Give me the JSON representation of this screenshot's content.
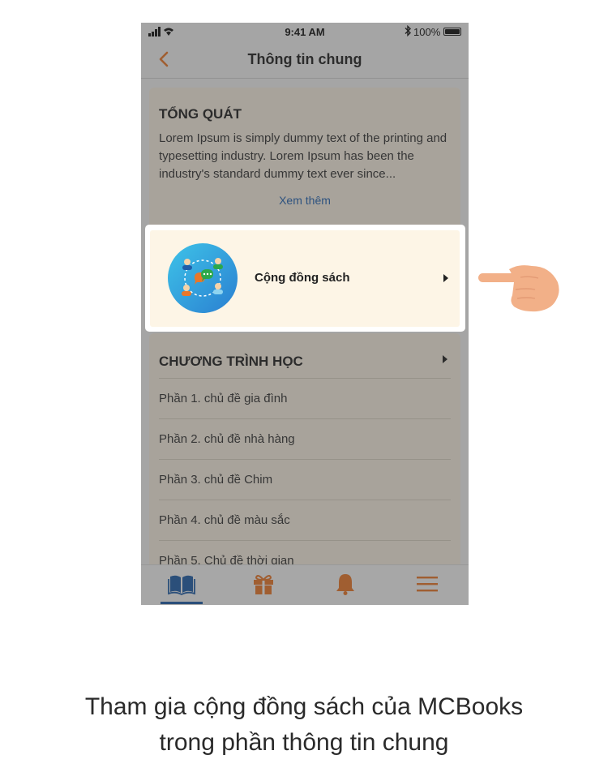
{
  "status_bar": {
    "time": "9:41 AM",
    "battery": "100%"
  },
  "nav": {
    "title": "Thông tin chung",
    "back_icon": "chevron-left-icon"
  },
  "overview": {
    "heading": "TỔNG QUÁT",
    "body": "Lorem Ipsum is simply dummy text of the printing and typesetting industry. Lorem Ipsum has been the industry's standard dummy text ever since...",
    "more_link": "Xem thêm"
  },
  "community": {
    "label": "Cộng đồng sách",
    "icon": "community-chat-icon"
  },
  "curriculum": {
    "heading": "CHƯƠNG TRÌNH HỌC",
    "lessons": [
      "Phần 1. chủ đề  gia đình",
      "Phần 2. chủ đề nhà hàng",
      "Phần 3. chủ đề Chim",
      "Phần 4. chủ đề màu sắc",
      "Phần 5. Chủ đề thời gian"
    ]
  },
  "tabbar": {
    "tabs": [
      {
        "icon": "book-icon",
        "active": true
      },
      {
        "icon": "gift-icon",
        "active": false
      },
      {
        "icon": "bell-icon",
        "active": false
      },
      {
        "icon": "menu-icon",
        "active": false
      }
    ]
  },
  "caption": {
    "line1": "Tham gia cộng đồng sách của MCBooks",
    "line2": "trong phần thông tin chung"
  },
  "colors": {
    "accent_orange": "#e8772a",
    "link_blue": "#2463b0",
    "card_bg": "#f6eee1",
    "highlight_bg": "#fdf5e6"
  }
}
